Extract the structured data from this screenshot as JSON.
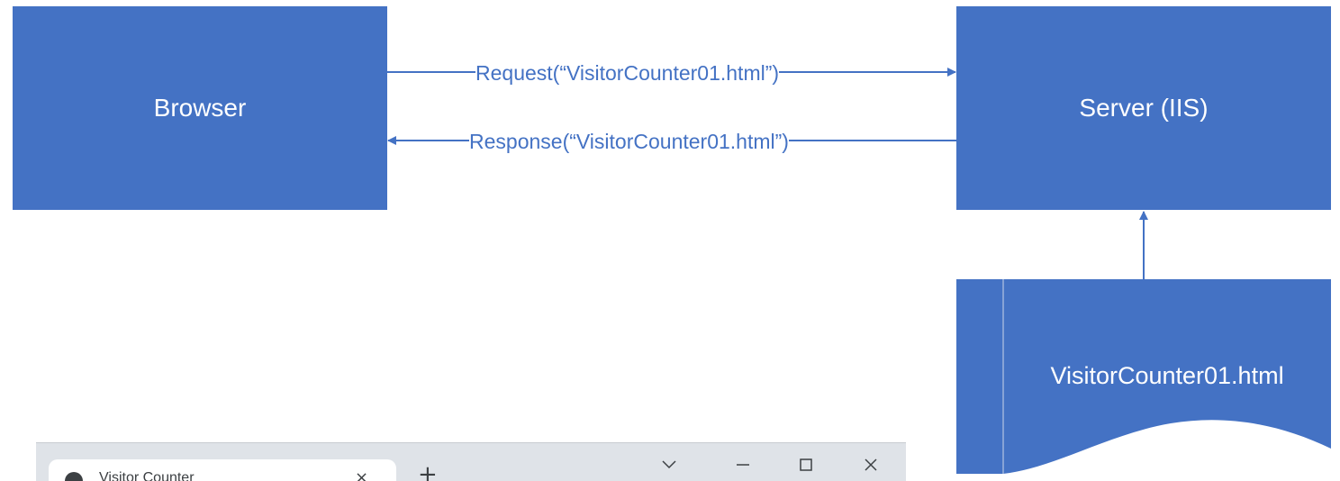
{
  "diagram": {
    "browser_label": "Browser",
    "server_label": "Server (IIS)",
    "request_label": "Request(“VisitorCounter01.html”)",
    "response_label": "Response(“VisitorCounter01.html”)",
    "document_label": "VisitorCounter01.html"
  },
  "browser_window": {
    "tab_title": "Visitor Counter",
    "tab_close_glyph": "×",
    "new_tab_glyph": "+",
    "icons": [
      "globe-icon",
      "close-icon",
      "chevron-down-icon",
      "minimize-icon",
      "maximize-icon",
      "window-close-icon"
    ]
  },
  "colors": {
    "shape_fill": "#4472c4",
    "connector": "#4472c4",
    "text_on_shape": "#ffffff"
  }
}
